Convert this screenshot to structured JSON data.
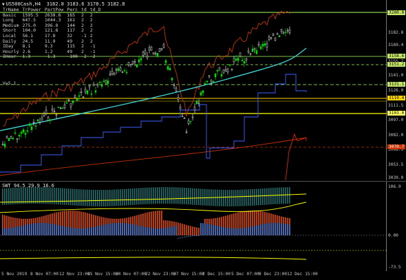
{
  "chart_title": "US500Cash,H4  3182.8 3183.6 3178.5 3182.8",
  "stats": {
    "headers": [
      "TrName",
      "TrPower",
      "PartPow",
      "Perc",
      "td",
      "td_D"
    ],
    "rows": [
      [
        "Basic",
        "1595.5",
        "2638.8",
        "165",
        "2",
        "2"
      ],
      [
        "Long",
        "647.5",
        "1044.3",
        "161",
        "2",
        "2"
      ],
      [
        "Medium",
        "275.0",
        "396.8",
        "144",
        "2",
        "2"
      ],
      [
        "Short",
        "104.0",
        "121.8",
        "117",
        "2",
        "2"
      ],
      [
        "Local",
        "56.1",
        "17.8",
        "32",
        "-1",
        "2"
      ],
      [
        "Daily",
        "24.5",
        "11.9",
        "49",
        "2",
        "2"
      ],
      [
        "IDay",
        "8.1",
        "9.3",
        "115",
        "2",
        "-1"
      ],
      [
        "Hourly",
        "2.6",
        "1.2",
        "49",
        "2",
        "-1"
      ],
      [
        "IHour",
        "1.3",
        "-1.3",
        "-100",
        "-2",
        "-2"
      ]
    ],
    "v_label": "V=5.1"
  },
  "price_labels": [
    "3182.8",
    "3169.4",
    "3155.7",
    "3141.0",
    "3126.0",
    "3111.5",
    "3097.0",
    "3082.0",
    "3068.0",
    "3053.5",
    "3039.0"
  ],
  "price_tags": [
    {
      "text": "3200.0",
      "bg": "#c8e86a"
    },
    {
      "text": "3158.6",
      "bg": "#c8e86a"
    },
    {
      "text": "3151.2",
      "bg": "#c8e86a"
    },
    {
      "text": "3131.1",
      "bg": "#c8e86a"
    },
    {
      "text": "3119.4",
      "bg": "#ffd700"
    },
    {
      "text": "3103.0",
      "bg": "#ffff66"
    },
    {
      "text": "3070.7",
      "bg": "#cc3300"
    }
  ],
  "sub_title": "SWT 94.5 29.9 16.6",
  "sub_labels": [
    "106.9",
    "0.00",
    "-73.5"
  ],
  "x_labels": [
    "5 Nov 2019",
    "8 Nov 07:00",
    "12 Nov 23:00",
    "15 Nov 15:00",
    "20 Nov 07:00",
    "22 Nov 23:00",
    "27 Nov 15:00",
    "2 Dec 15:00",
    "5 Dec 07:00",
    "9 Dec 23:00",
    "12 Dec 15:00"
  ],
  "colors": {
    "candle_up": "#00e000",
    "candle_down": "#e0e0e0",
    "ma_cyan": "#40d0d0",
    "envelope_red": "#c83200",
    "blue_step": "#4060ff",
    "yellow_line": "#ffff00",
    "green_line": "#a8ff60"
  }
}
